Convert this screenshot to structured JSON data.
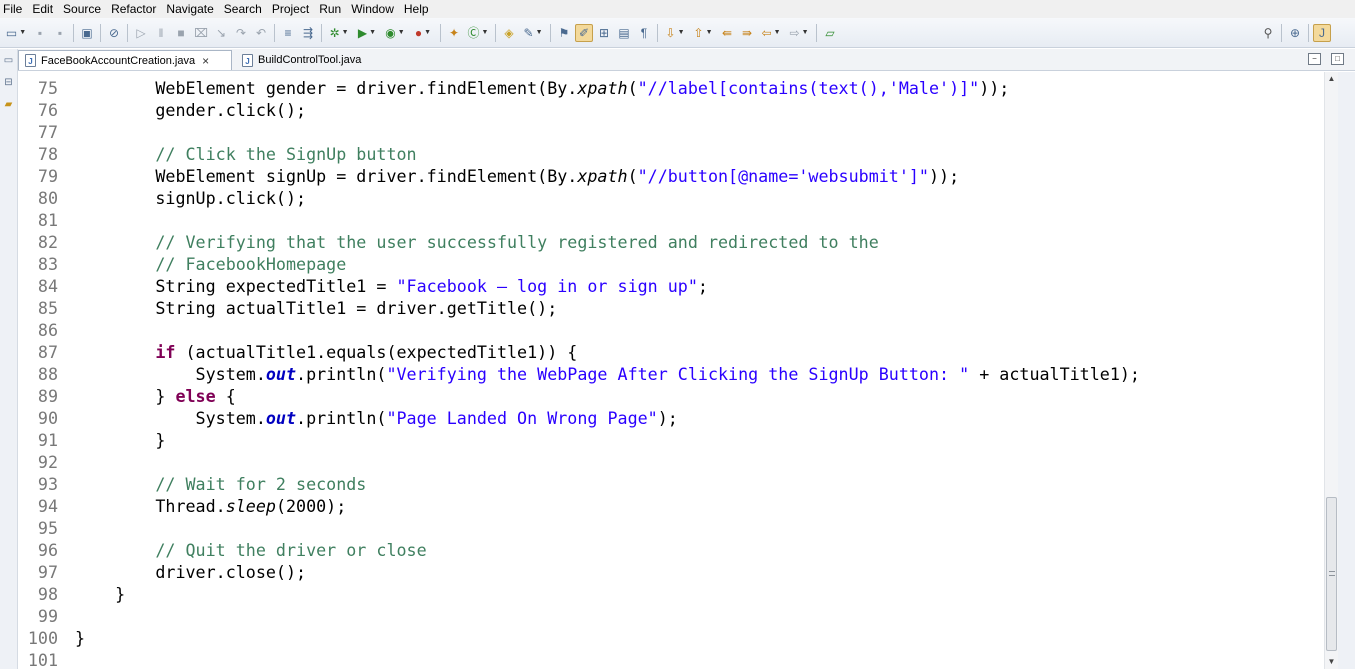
{
  "menu": [
    "File",
    "Edit",
    "Source",
    "Refactor",
    "Navigate",
    "Search",
    "Project",
    "Run",
    "Window",
    "Help"
  ],
  "toolbar_icons": {
    "new": "new-wizard-icon",
    "save": "save-icon",
    "save_all": "save-all-icon",
    "debug": "debug-icon",
    "run": "run-icon",
    "search": "search-icon",
    "perspective": "open-perspective-icon"
  },
  "tabs": [
    {
      "label": "FaceBookAccountCreation.java",
      "icon": "J",
      "close": "×",
      "active": true
    },
    {
      "label": "BuildControlTool.java",
      "icon": "J",
      "active": false
    }
  ],
  "view_controls": {
    "minimize": "−",
    "maximize": "□"
  },
  "colors": {
    "keyword": "#7f0055",
    "string": "#2a00ff",
    "comment": "#3f7f5f",
    "field": "#0000c0",
    "line_number": "#787878"
  },
  "code_lines": [
    {
      "n": "75",
      "parts": [
        [
          "",
          "        WebElement gender = driver.findElement(By."
        ],
        [
          "it",
          "xpath"
        ],
        [
          "",
          "("
        ],
        [
          "str",
          "\"//label[contains(text(),'Male')]\""
        ],
        [
          "",
          "));"
        ]
      ]
    },
    {
      "n": "76",
      "parts": [
        [
          "",
          "        gender.click();"
        ]
      ]
    },
    {
      "n": "77",
      "parts": []
    },
    {
      "n": "78",
      "parts": [
        [
          "cm",
          "        // Click the SignUp button"
        ]
      ]
    },
    {
      "n": "79",
      "parts": [
        [
          "",
          "        WebElement signUp = driver.findElement(By."
        ],
        [
          "it",
          "xpath"
        ],
        [
          "",
          "("
        ],
        [
          "str",
          "\"//button[@name='websubmit']\""
        ],
        [
          "",
          "));"
        ]
      ]
    },
    {
      "n": "80",
      "parts": [
        [
          "",
          "        signUp.click();"
        ]
      ]
    },
    {
      "n": "81",
      "parts": []
    },
    {
      "n": "82",
      "parts": [
        [
          "cm",
          "        // Verifying that the user successfully registered and redirected to the"
        ]
      ]
    },
    {
      "n": "83",
      "parts": [
        [
          "cm",
          "        // FacebookHomepage"
        ]
      ]
    },
    {
      "n": "84",
      "parts": [
        [
          "",
          "        String expectedTitle1 = "
        ],
        [
          "str",
          "\"Facebook – log in or sign up\""
        ],
        [
          "",
          ";"
        ]
      ]
    },
    {
      "n": "85",
      "parts": [
        [
          "",
          "        String actualTitle1 = driver.getTitle();"
        ]
      ]
    },
    {
      "n": "86",
      "parts": []
    },
    {
      "n": "87",
      "parts": [
        [
          "",
          "        "
        ],
        [
          "kw",
          "if"
        ],
        [
          "",
          " (actualTitle1.equals(expectedTitle1)) {"
        ]
      ]
    },
    {
      "n": "88",
      "parts": [
        [
          "",
          "            System."
        ],
        [
          "fld",
          "out"
        ],
        [
          "",
          ".println("
        ],
        [
          "str",
          "\"Verifying the WebPage After Clicking the SignUp Button: \""
        ],
        [
          "",
          " + actualTitle1);"
        ]
      ]
    },
    {
      "n": "89",
      "parts": [
        [
          "",
          "        } "
        ],
        [
          "kw",
          "else"
        ],
        [
          "",
          " {"
        ]
      ]
    },
    {
      "n": "90",
      "parts": [
        [
          "",
          "            System."
        ],
        [
          "fld",
          "out"
        ],
        [
          "",
          ".println("
        ],
        [
          "str",
          "\"Page Landed On Wrong Page\""
        ],
        [
          "",
          ");"
        ]
      ]
    },
    {
      "n": "91",
      "parts": [
        [
          "",
          "        }"
        ]
      ]
    },
    {
      "n": "92",
      "parts": []
    },
    {
      "n": "93",
      "parts": [
        [
          "cm",
          "        // Wait for 2 seconds"
        ]
      ]
    },
    {
      "n": "94",
      "parts": [
        [
          "",
          "        Thread."
        ],
        [
          "it",
          "sleep"
        ],
        [
          "",
          "(2000);"
        ]
      ]
    },
    {
      "n": "95",
      "parts": []
    },
    {
      "n": "96",
      "parts": [
        [
          "cm",
          "        // Quit the driver or close"
        ]
      ]
    },
    {
      "n": "97",
      "parts": [
        [
          "",
          "        driver.close();"
        ]
      ]
    },
    {
      "n": "98",
      "parts": [
        [
          "",
          "    }"
        ]
      ]
    },
    {
      "n": "99",
      "parts": []
    },
    {
      "n": "100",
      "parts": [
        [
          "",
          "}"
        ]
      ]
    },
    {
      "n": "101",
      "parts": []
    }
  ],
  "scrollbar": {
    "position_fraction": 0.78
  }
}
